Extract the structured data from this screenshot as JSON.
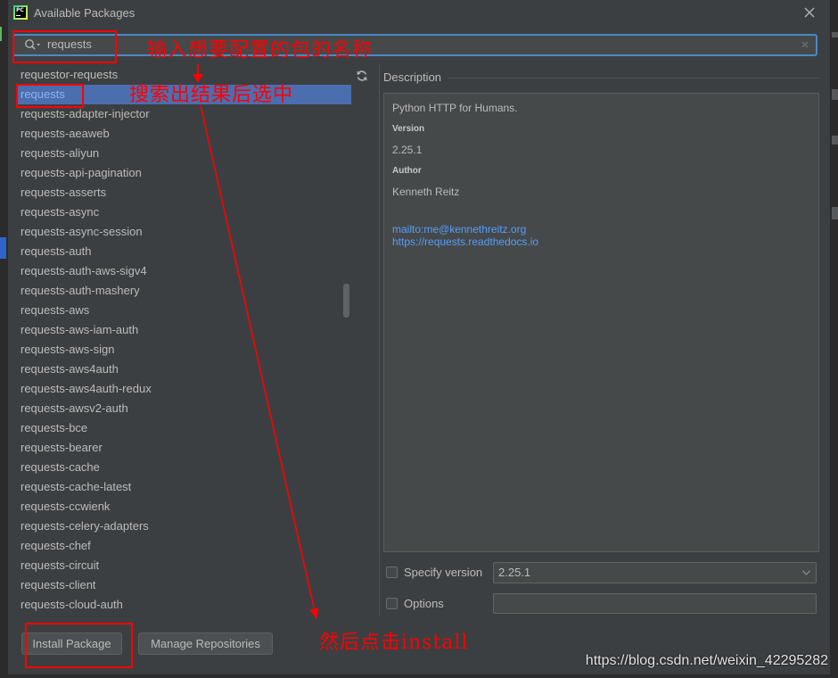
{
  "window": {
    "title": "Available Packages",
    "app_icon": "pycharm-logo-icon",
    "app_icon_text": "PC",
    "close_icon": "close-icon"
  },
  "search": {
    "value": "requests",
    "icon": "search-history-icon",
    "clear_icon": "clear-icon"
  },
  "packages": {
    "refresh_icon": "refresh-icon",
    "selected_index": 1,
    "items": [
      "requestor-requests",
      "requests",
      "requests-adapter-injector",
      "requests-aeaweb",
      "requests-aliyun",
      "requests-api-pagination",
      "requests-asserts",
      "requests-async",
      "requests-async-session",
      "requests-auth",
      "requests-auth-aws-sigv4",
      "requests-auth-mashery",
      "requests-aws",
      "requests-aws-iam-auth",
      "requests-aws-sign",
      "requests-aws4auth",
      "requests-aws4auth-redux",
      "requests-awsv2-auth",
      "requests-bce",
      "requests-bearer",
      "requests-cache",
      "requests-cache-latest",
      "requests-ccwienk",
      "requests-celery-adapters",
      "requests-chef",
      "requests-circuit",
      "requests-client",
      "requests-cloud-auth"
    ]
  },
  "description": {
    "label": "Description",
    "summary": "Python HTTP for Humans.",
    "version_label": "Version",
    "version": "2.25.1",
    "author_label": "Author",
    "author": "Kenneth Reitz",
    "links": [
      "mailto:me@kennethreitz.org",
      "https://requests.readthedocs.io"
    ]
  },
  "options": {
    "specify_version_label": "Specify version",
    "specify_version_checked": false,
    "version_value": "2.25.1",
    "dropdown_icon": "chevron-down-icon",
    "options_label": "Options",
    "options_checked": false
  },
  "buttons": {
    "install": "Install Package",
    "manage": "Manage Repositories"
  },
  "annotations": {
    "search_hint": "输入想要配置的包的名称",
    "select_hint": "搜索出结果后选中",
    "install_hint": "然后点击install"
  },
  "watermark": "https://blog.csdn.net/weixin_42295282",
  "colors": {
    "dialog_bg": "#3c3f41",
    "text": "#bbbbbb",
    "selection": "#4b6eaf",
    "selected_text": "#8cb4f0",
    "link": "#589df6",
    "focus_border": "#4a88c7",
    "annotation": "#ff0000"
  }
}
